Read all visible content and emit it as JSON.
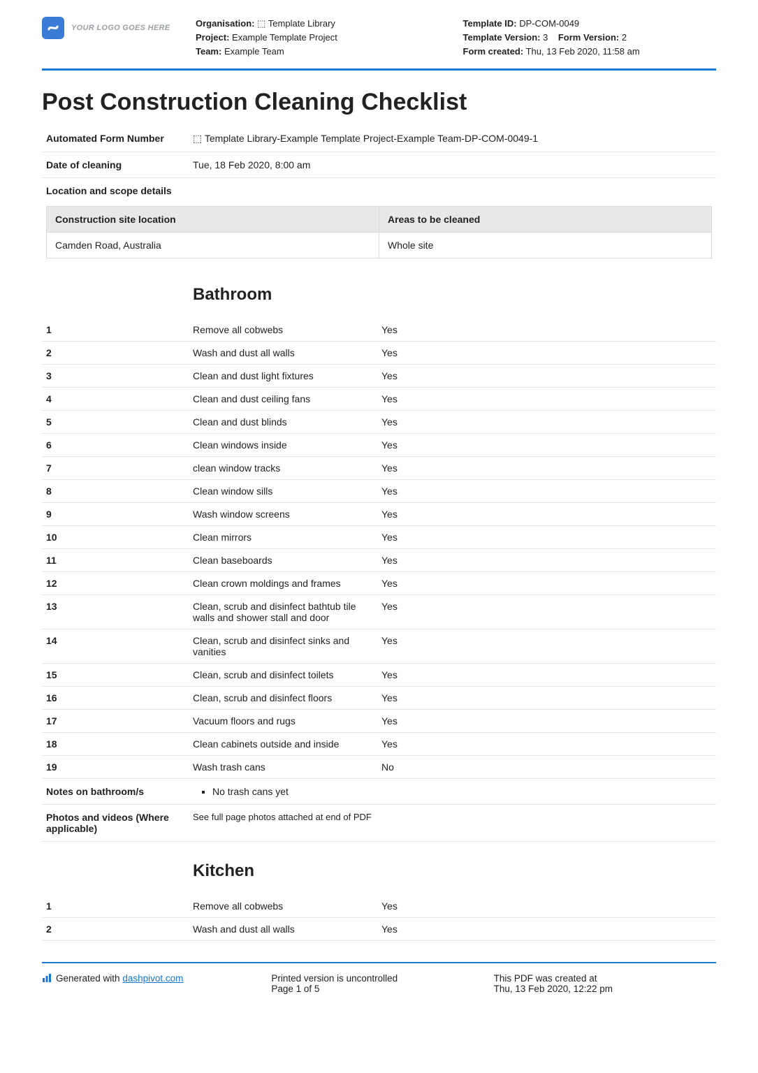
{
  "header": {
    "logo_text": "YOUR LOGO GOES HERE",
    "org_label": "Organisation:",
    "org_value": "⬚ Template Library",
    "project_label": "Project:",
    "project_value": "Example Template Project",
    "team_label": "Team:",
    "team_value": "Example Team",
    "template_id_label": "Template ID:",
    "template_id_value": "DP-COM-0049",
    "template_version_label": "Template Version:",
    "template_version_value": "3",
    "form_version_label": "Form Version:",
    "form_version_value": "2",
    "form_created_label": "Form created:",
    "form_created_value": "Thu, 13 Feb 2020, 11:58 am"
  },
  "title": "Post Construction Cleaning Checklist",
  "form": {
    "auto_num_label": "Automated Form Number",
    "auto_num_value": "⬚ Template Library-Example Template Project-Example Team-DP-COM-0049-1",
    "date_label": "Date of cleaning",
    "date_value": "Tue, 18 Feb 2020, 8:00 am",
    "loc_scope_label": "Location and scope details",
    "loc_table": {
      "h1": "Construction site location",
      "h2": "Areas to be cleaned",
      "r1c1": "Camden Road, Australia",
      "r1c2": "Whole site"
    }
  },
  "bathroom": {
    "heading": "Bathroom",
    "items": [
      {
        "n": "1",
        "task": "Remove all cobwebs",
        "ans": "Yes"
      },
      {
        "n": "2",
        "task": "Wash and dust all walls",
        "ans": "Yes"
      },
      {
        "n": "3",
        "task": "Clean and dust light fixtures",
        "ans": "Yes"
      },
      {
        "n": "4",
        "task": "Clean and dust ceiling fans",
        "ans": "Yes"
      },
      {
        "n": "5",
        "task": "Clean and dust blinds",
        "ans": "Yes"
      },
      {
        "n": "6",
        "task": "Clean windows inside",
        "ans": "Yes"
      },
      {
        "n": "7",
        "task": "clean window tracks",
        "ans": "Yes"
      },
      {
        "n": "8",
        "task": "Clean window sills",
        "ans": "Yes"
      },
      {
        "n": "9",
        "task": "Wash window screens",
        "ans": "Yes"
      },
      {
        "n": "10",
        "task": "Clean mirrors",
        "ans": "Yes"
      },
      {
        "n": "11",
        "task": "Clean baseboards",
        "ans": "Yes"
      },
      {
        "n": "12",
        "task": "Clean crown moldings and frames",
        "ans": "Yes"
      },
      {
        "n": "13",
        "task": "Clean, scrub and disinfect bathtub tile walls and shower stall and door",
        "ans": "Yes"
      },
      {
        "n": "14",
        "task": "Clean, scrub and disinfect sinks and vanities",
        "ans": "Yes"
      },
      {
        "n": "15",
        "task": "Clean, scrub and disinfect toilets",
        "ans": "Yes"
      },
      {
        "n": "16",
        "task": "Clean, scrub and disinfect floors",
        "ans": "Yes"
      },
      {
        "n": "17",
        "task": "Vacuum floors and rugs",
        "ans": "Yes"
      },
      {
        "n": "18",
        "task": "Clean cabinets outside and inside",
        "ans": "Yes"
      },
      {
        "n": "19",
        "task": "Wash trash cans",
        "ans": "No"
      }
    ],
    "notes_label": "Notes on bathroom/s",
    "notes_bullet": "No trash cans yet",
    "photos_label": "Photos and videos (Where applicable)",
    "photos_value": "See full page photos attached at end of PDF"
  },
  "kitchen": {
    "heading": "Kitchen",
    "items": [
      {
        "n": "1",
        "task": "Remove all cobwebs",
        "ans": "Yes"
      },
      {
        "n": "2",
        "task": "Wash and dust all walls",
        "ans": "Yes"
      }
    ]
  },
  "footer": {
    "generated_prefix": "Generated with ",
    "generated_link": "dashpivot.com",
    "uncontrolled": "Printed version is uncontrolled",
    "page": "Page 1 of 5",
    "created_label": "This PDF was created at",
    "created_value": "Thu, 13 Feb 2020, 12:22 pm"
  }
}
